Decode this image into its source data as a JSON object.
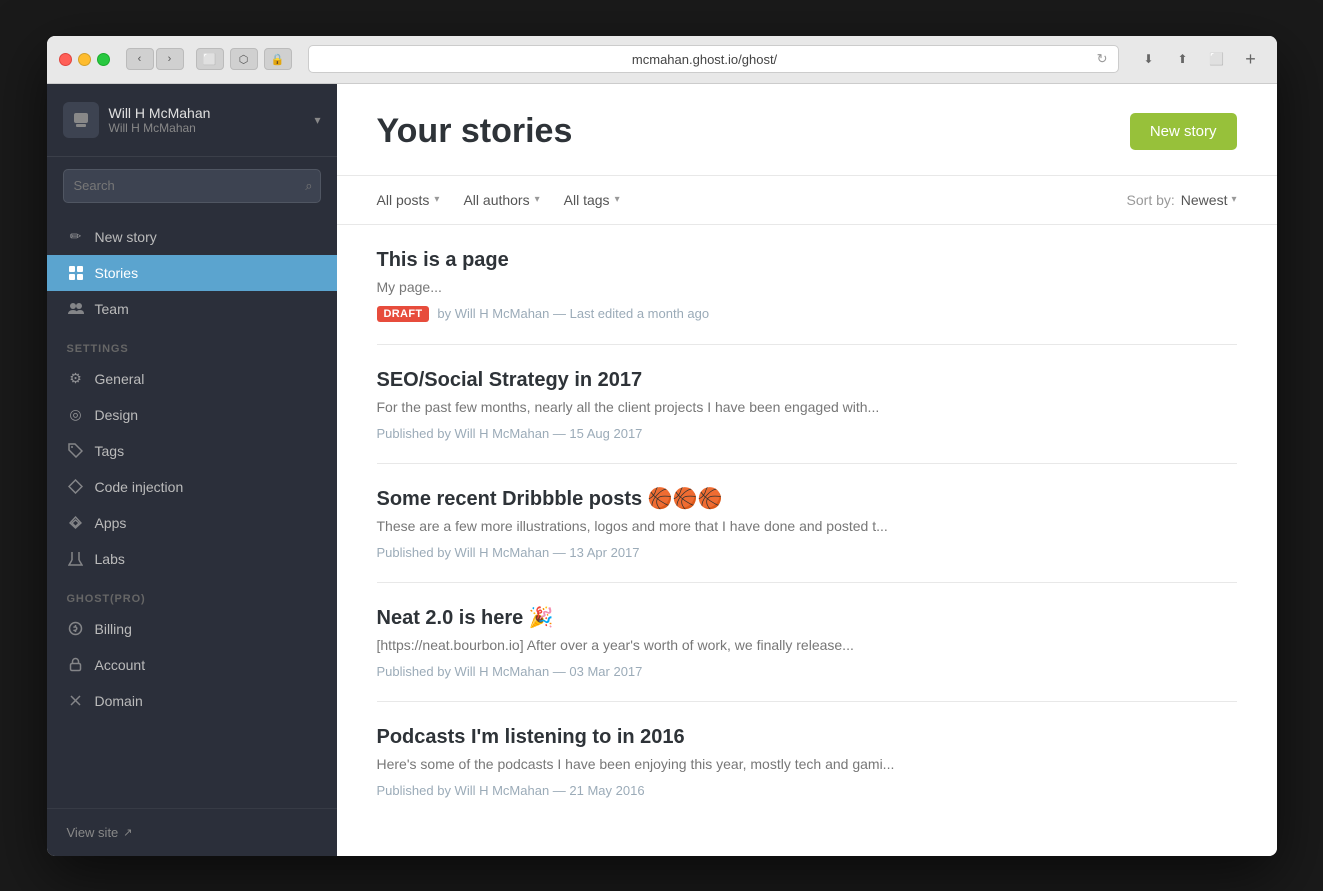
{
  "browser": {
    "url": "mcmahan.ghost.io/ghost/"
  },
  "sidebar": {
    "user": {
      "name": "Will H McMahan",
      "email": "Will H McMahan"
    },
    "search_placeholder": "Search",
    "nav_items": [
      {
        "id": "new-story",
        "label": "New story",
        "icon": "✏"
      },
      {
        "id": "stories",
        "label": "Stories",
        "icon": "▦",
        "active": true
      },
      {
        "id": "team",
        "label": "Team",
        "icon": "👥"
      }
    ],
    "settings_label": "SETTINGS",
    "settings_items": [
      {
        "id": "general",
        "label": "General",
        "icon": "⚙"
      },
      {
        "id": "design",
        "label": "Design",
        "icon": "◎"
      },
      {
        "id": "tags",
        "label": "Tags",
        "icon": "⬡"
      },
      {
        "id": "code-injection",
        "label": "Code injection",
        "icon": "◇"
      },
      {
        "id": "apps",
        "label": "Apps",
        "icon": "⬡"
      },
      {
        "id": "labs",
        "label": "Labs",
        "icon": "✂"
      }
    ],
    "ghost_pro_label": "GHOST(PRO)",
    "ghost_pro_items": [
      {
        "id": "billing",
        "label": "Billing",
        "icon": "◉"
      },
      {
        "id": "account",
        "label": "Account",
        "icon": "🔒"
      },
      {
        "id": "domain",
        "label": "Domain",
        "icon": "✂"
      }
    ],
    "view_site": "View site"
  },
  "main": {
    "title": "Your stories",
    "new_story_button": "New story",
    "filters": {
      "all_posts": "All posts",
      "all_authors": "All authors",
      "all_tags": "All tags"
    },
    "sort": {
      "label": "Sort by:",
      "value": "Newest"
    },
    "posts": [
      {
        "id": "post-1",
        "title": "This is a page",
        "excerpt": "My page...",
        "draft": true,
        "draft_label": "Draft",
        "meta": "by Will H McMahan — Last edited a month ago"
      },
      {
        "id": "post-2",
        "title": "SEO/Social Strategy in 2017",
        "excerpt": "For the past few months, nearly all the client projects I have been engaged with...",
        "draft": false,
        "meta": "Published by Will H McMahan — 15 Aug 2017"
      },
      {
        "id": "post-3",
        "title": "Some recent Dribbble posts 🏀🏀🏀",
        "excerpt": "These are a few more illustrations, logos and more that I have done and posted t...",
        "draft": false,
        "meta": "Published by Will H McMahan — 13 Apr 2017"
      },
      {
        "id": "post-4",
        "title": "Neat 2.0 is here 🎉",
        "excerpt": "[https://neat.bourbon.io] After over a year's worth of work, we finally release...",
        "draft": false,
        "meta": "Published by Will H McMahan — 03 Mar 2017"
      },
      {
        "id": "post-5",
        "title": "Podcasts I'm listening to in 2016",
        "excerpt": "Here's some of the podcasts I have been enjoying this year, mostly tech and gami...",
        "draft": false,
        "meta": "Published by Will H McMahan — 21 May 2016"
      }
    ]
  }
}
